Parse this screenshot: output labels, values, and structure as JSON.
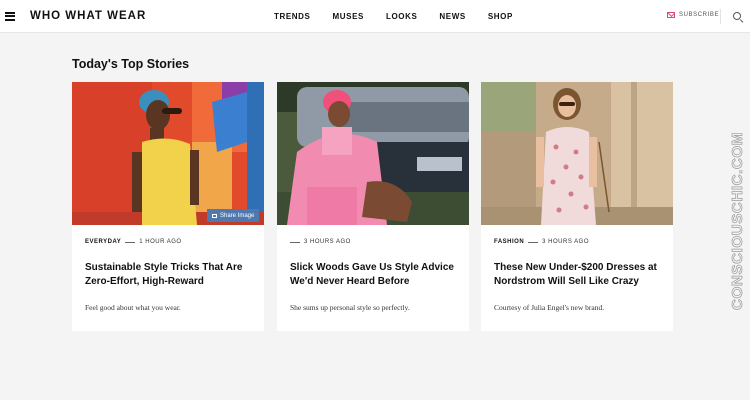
{
  "header": {
    "logo": "WHO WHAT WEAR",
    "nav": [
      "TRENDS",
      "MUSES",
      "LOOKS",
      "NEWS",
      "SHOP"
    ],
    "subscribe_label": "SUBSCRIBE",
    "colors": {
      "accent": "#e0457b"
    }
  },
  "main": {
    "section_title": "Today's Top Stories",
    "cards": [
      {
        "category": "EVERYDAY",
        "time": "1 HOUR AGO",
        "headline": "Sustainable Style Tricks That Are Zero-Effort, High-Reward",
        "dek": "Feel good about what you wear.",
        "share_label": "Share Image"
      },
      {
        "category": "",
        "time": "3 HOURS AGO",
        "headline": "Slick Woods Gave Us Style Advice We'd Never Heard Before",
        "dek": "She sums up personal style so perfectly."
      },
      {
        "category": "FASHION",
        "time": "3 HOURS AGO",
        "headline": "These New Under-$200 Dresses at Nordstrom Will Sell Like Crazy",
        "dek": "Courtesy of Julia Engel's new brand."
      }
    ]
  },
  "watermark": "CONSCIOUSCHIC.COM"
}
